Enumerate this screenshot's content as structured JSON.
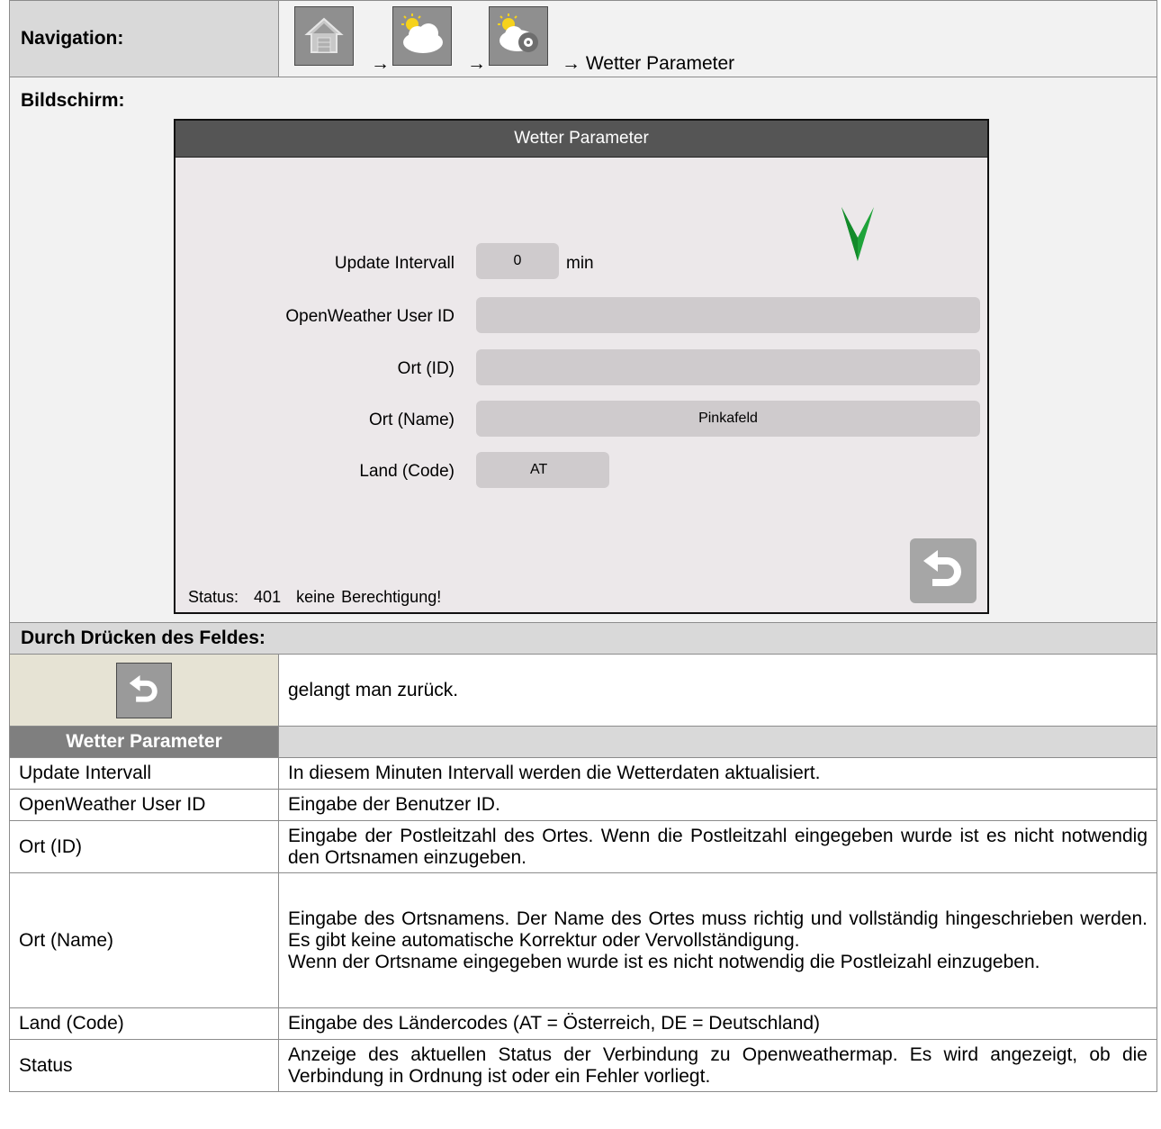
{
  "navigation": {
    "label": "Navigation:",
    "arrow": "→",
    "target": "→ Wetter Parameter",
    "icons": [
      "home-icon",
      "weather-icon",
      "weather-settings-icon"
    ]
  },
  "screen": {
    "label": "Bildschirm:",
    "title": "Wetter Parameter",
    "fields": {
      "update_interval": {
        "label": "Update Intervall",
        "value": "0",
        "unit": "min"
      },
      "user_id": {
        "label": "OpenWeather User ID",
        "value": ""
      },
      "ort_id": {
        "label": "Ort (ID)",
        "value": ""
      },
      "ort_name": {
        "label": "Ort (Name)",
        "value": "Pinkafeld"
      },
      "land_code": {
        "label": "Land (Code)",
        "value": "AT"
      }
    },
    "status_label": "Status:",
    "status_code": "401",
    "status_text": "keine Berechtigung!",
    "colors": {
      "header": "#555555",
      "screen_bg": "#ece8ea",
      "field": "#cfcbcd",
      "check": "#1fa33a"
    }
  },
  "press_section": {
    "heading": "Durch Drücken des Feldes:",
    "back_description": "gelangt man zurück."
  },
  "params_table": {
    "heading": "Wetter Parameter",
    "rows": [
      {
        "name": "Update Intervall",
        "desc": [
          "In diesem Minuten Intervall werden die Wetterdaten aktualisiert."
        ]
      },
      {
        "name": "OpenWeather User ID",
        "desc": [
          "Eingabe der Benutzer ID."
        ]
      },
      {
        "name": "Ort (ID)",
        "desc": [
          "Eingabe der Postleitzahl des Ortes. Wenn die Postleitzahl eingegeben wurde ist es nicht notwendig den Ortsnamen einzugeben."
        ]
      },
      {
        "name": "Ort (Name)",
        "desc": [
          "Eingabe des Ortsnamens. Der Name des Ortes muss richtig und vollständig hingeschrieben werden. Es gibt keine automatische Korrektur oder Vervollständigung.",
          "Wenn der Ortsname eingegeben wurde ist es nicht notwendig die Postleizahl einzugeben."
        ]
      },
      {
        "name": "Land (Code)",
        "desc": [
          "Eingabe des Ländercodes (AT = Österreich, DE = Deutschland)"
        ]
      },
      {
        "name": "Status",
        "desc": [
          "Anzeige des aktuellen Status der Verbindung zu Openweathermap. Es wird angezeigt, ob die Verbindung in Ordnung ist oder ein Fehler vorliegt."
        ]
      }
    ]
  }
}
